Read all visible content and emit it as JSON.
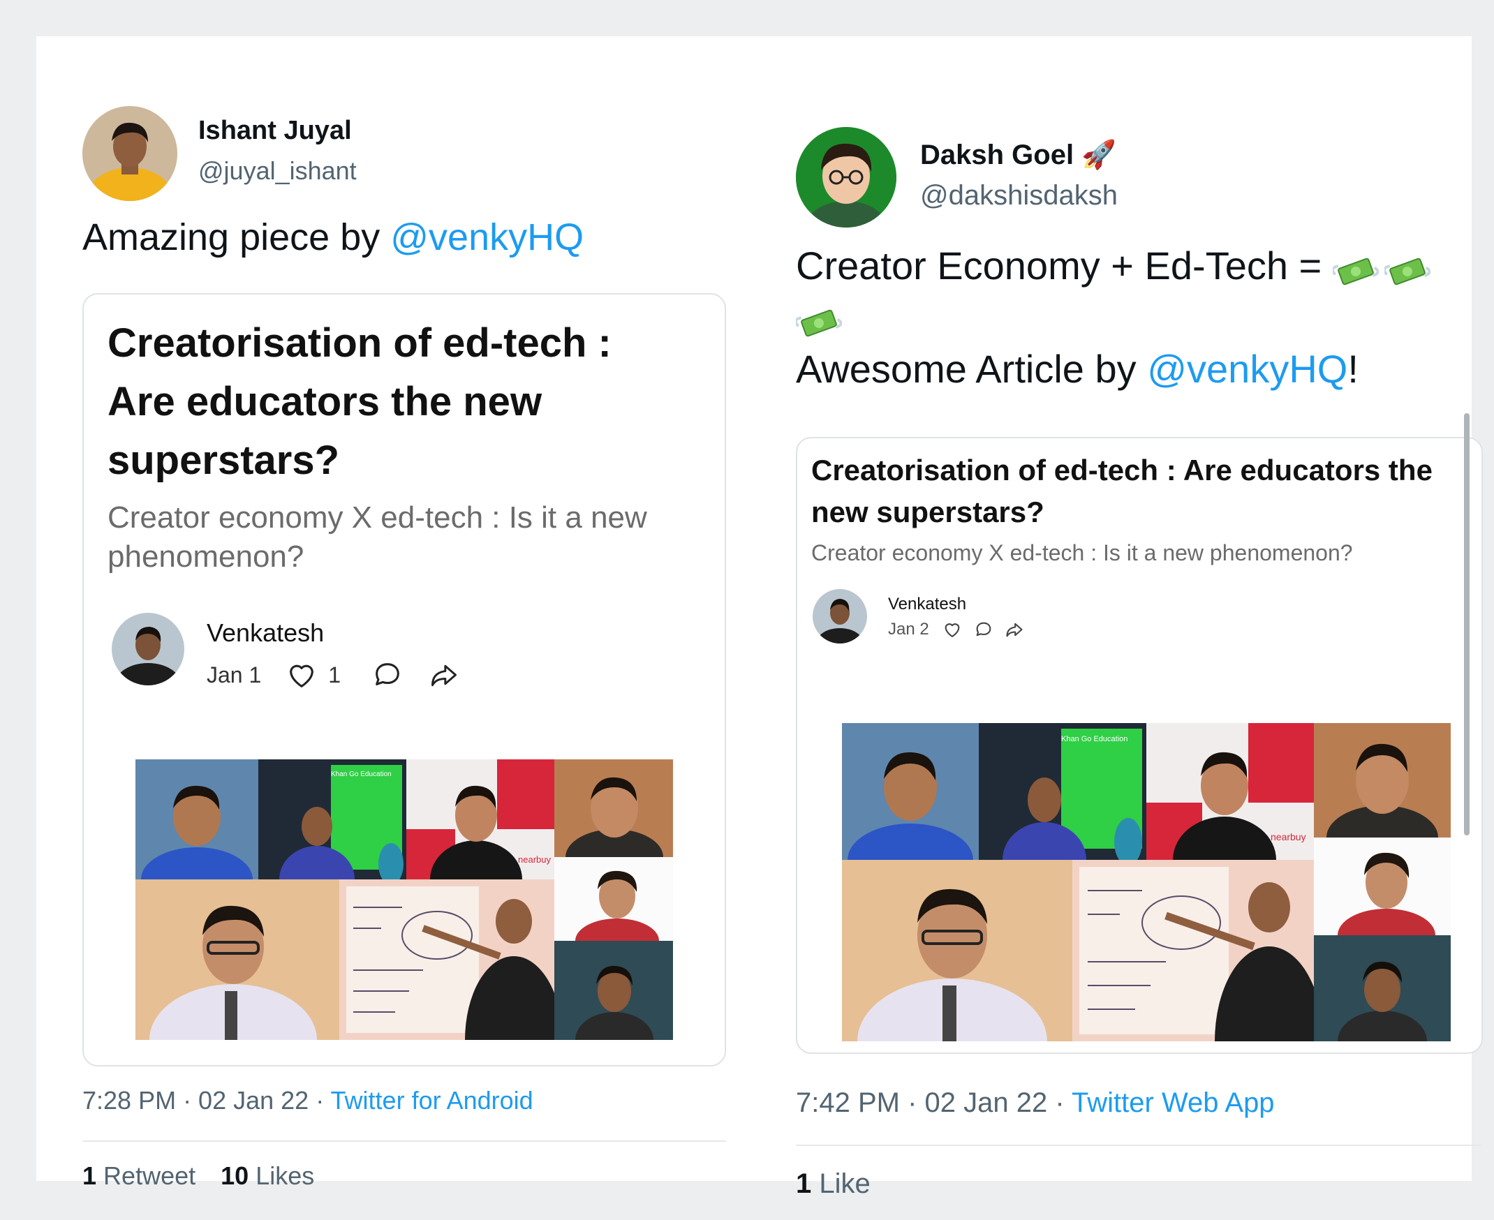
{
  "tweets": [
    {
      "name": "Ishant Juyal",
      "handle": "@juyal_ishant",
      "text_prefix": "Amazing piece by ",
      "mention": "@venkyHQ",
      "card": {
        "title": "Creatorisation of ed-tech : Are educators the new superstars?",
        "subtitle": "Creator economy X ed-tech : Is it a new phenomenon?",
        "author": "Venkatesh",
        "date": "Jan 1",
        "like_count": "1"
      },
      "timestamp": "7:28 PM · 02 Jan 22 · ",
      "source": "Twitter for Android",
      "retweets": "1",
      "retweets_label": "Retweet",
      "likes": "10",
      "likes_label": "Likes"
    },
    {
      "name": "Daksh Goel",
      "name_emoji": "🚀",
      "handle": "@dakshisdaksh",
      "line1": "Creator Economy + Ed-Tech = ",
      "line2_prefix": "Awesome Article by ",
      "mention": "@venkyHQ",
      "line2_suffix": "!",
      "emoji_names": [
        "money-with-wings-icon",
        "money-with-wings-icon",
        "money-with-wings-icon"
      ],
      "card": {
        "title": "Creatorisation of ed-tech : Are educators the new superstars?",
        "subtitle": "Creator economy X ed-tech : Is it a new phenomenon?",
        "author": "Venkatesh",
        "date": "Jan 2"
      },
      "timestamp": "7:42 PM · 02 Jan 22 · ",
      "source": "Twitter Web App",
      "likes": "1",
      "likes_label": "Like"
    }
  ],
  "collage_image_text": [
    "Khan Go Education",
    "nearbuy"
  ],
  "colors": {
    "mention": "#1d9bf0",
    "secondary": "#536471",
    "background": "#ffffff"
  }
}
